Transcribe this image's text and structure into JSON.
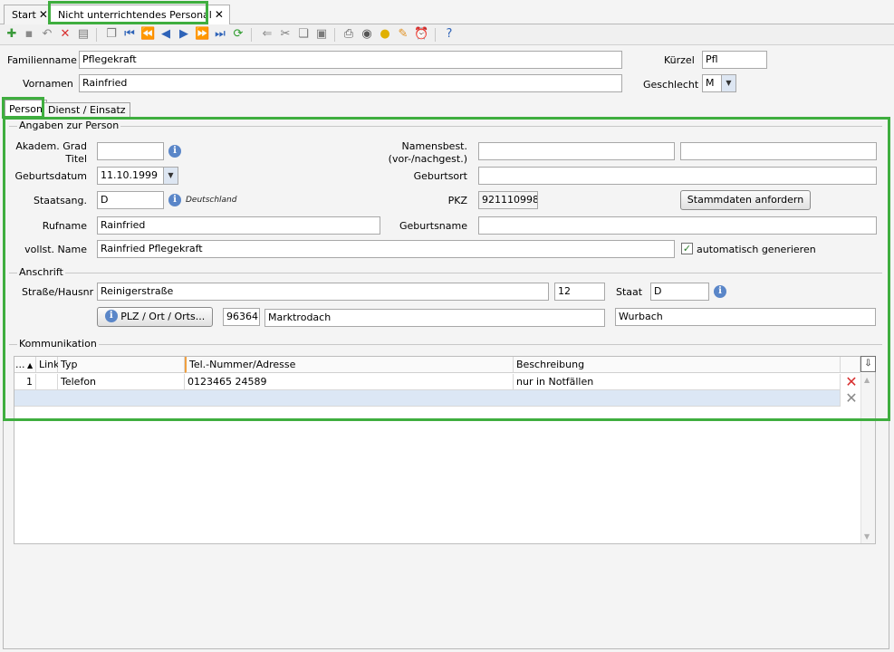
{
  "tabs": [
    {
      "label": "Start",
      "close": "✕"
    },
    {
      "label": "Nicht unterrichtendes Personal",
      "close": "✕"
    }
  ],
  "header": {
    "familienname_label": "Familienname",
    "familienname_value": "Pflegekraft",
    "kuerzel_label": "Kürzel",
    "kuerzel_value": "Pfl",
    "vornamen_label": "Vornamen",
    "vornamen_value": "Rainfried",
    "geschlecht_label": "Geschlecht",
    "geschlecht_value": "M"
  },
  "subtabs": [
    {
      "label": "Person"
    },
    {
      "label": "Dienst / Einsatz"
    }
  ],
  "person": {
    "group_title": "Angaben zur Person",
    "akadem_grad_label": "Akadem. Grad",
    "titel_label": "Titel",
    "akadem_grad_value": "",
    "namensbest_label": "Namensbest.",
    "namensbest_sub_label": "(vor-/nachgest.)",
    "namensbest_vor": "",
    "namensbest_nach": "",
    "geburtsdatum_label": "Geburtsdatum",
    "geburtsdatum_value": "11.10.1999",
    "geburtsort_label": "Geburtsort",
    "geburtsort_value": "",
    "staatsang_label": "Staatsang.",
    "staatsang_value": "D",
    "staatsang_text": "Deutschland",
    "pkz_label": "PKZ",
    "pkz_value": "921110998",
    "stammdaten_button": "Stammdaten anfordern",
    "rufname_label": "Rufname",
    "rufname_value": "Rainfried",
    "geburtsname_label": "Geburtsname",
    "geburtsname_value": "",
    "vollst_name_label": "vollst. Name",
    "vollst_name_value": "Rainfried  Pflegekraft",
    "auto_label": "automatisch generieren",
    "auto_checked": true
  },
  "anschrift": {
    "group_title": "Anschrift",
    "strasse_label": "Straße/Hausnr",
    "strasse_value": "Reinigerstraße",
    "hausnr_value": "12",
    "staat_label": "Staat",
    "staat_value": "D",
    "plz_button": "PLZ / Ort / Orts...",
    "plz_value": "96364",
    "ort_value": "Marktrodach",
    "ortsteil_value": "Wurbach"
  },
  "kommunikation": {
    "group_title": "Kommunikation",
    "columns": [
      "...",
      "Link",
      "Typ",
      "Tel.-Nummer/Adresse",
      "Beschreibung"
    ],
    "rows": [
      {
        "nr": "1",
        "link": "",
        "typ": "Telefon",
        "adresse": "0123465 24589",
        "beschreibung": "nur in Notfällen"
      }
    ]
  },
  "icons": {
    "info": "info-icon",
    "delete": "delete-row-icon",
    "checkmark": "checkmark-icon"
  },
  "colors": {
    "highlight": "#3fae3f",
    "info_blue": "#5a86c8",
    "delete_red": "#d83030"
  }
}
